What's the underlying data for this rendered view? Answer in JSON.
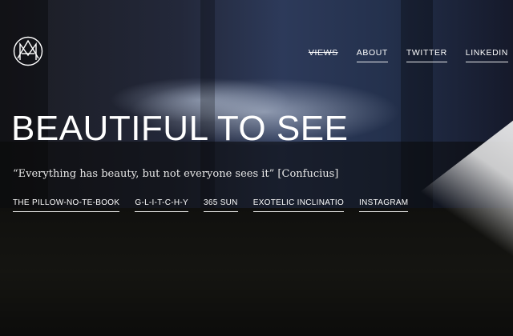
{
  "nav": {
    "items": [
      {
        "label": "VIEWS"
      },
      {
        "label": "ABOUT"
      },
      {
        "label": "TWITTER"
      },
      {
        "label": "LINKEDIN"
      }
    ]
  },
  "hero": {
    "title": "BEAUTIFUL TO SEE",
    "quote": "“Everything has beauty, but not everyone sees it” [Confucius]"
  },
  "links": [
    {
      "label": "THE PILLOW-NO-TE-BOOK"
    },
    {
      "label": "G-L-I-T-C-H-Y"
    },
    {
      "label": "365 SUN"
    },
    {
      "label": "EXOTELIC INCLINATIO"
    },
    {
      "label": "INSTAGRAM"
    }
  ],
  "icons": {
    "logo": "monogram-logo-icon"
  },
  "colors": {
    "text": "#ffffff",
    "background": "#0b0b0d"
  }
}
